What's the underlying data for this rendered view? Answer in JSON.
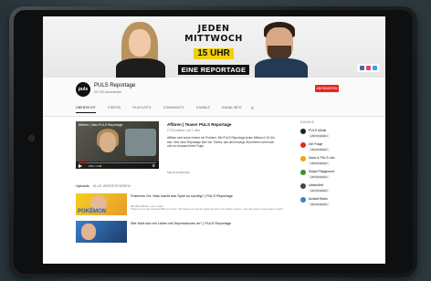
{
  "banner": {
    "line1": "JEDEN",
    "line2": "MITTWOCH",
    "line3": "15 UHR",
    "line4": "EINE REPORTAGE"
  },
  "channel": {
    "avatar_text": "puls",
    "name": "PULS Reportage",
    "subscribers": "60.726 Abonnenten",
    "subscribe_label": "ABONNIEREN"
  },
  "tabs": [
    {
      "label": "ÜBERSICHT",
      "active": true
    },
    {
      "label": "VIDEOS",
      "active": false
    },
    {
      "label": "PLAYLISTS",
      "active": false
    },
    {
      "label": "COMMUNITY",
      "active": false
    },
    {
      "label": "KANÄLE",
      "active": false
    },
    {
      "label": "KANALINFO",
      "active": false
    }
  ],
  "featured": {
    "video_title": "Affären | Was PULS Reportage",
    "time": "0:01 / 1:23",
    "title": "Affären | Teaser PULS Reportage",
    "meta": "2.720 Aufrufe • vor 1 Jahr",
    "description": "Affären sind schon immer ein Problem. Bei PULS Reportage jeden Mittwoch 15 Uhr neu: eine neue Reportage über ein Thema, das dich bewegt. Abonnieren lohnt sich und du verpasst keine Folge.",
    "more": "MEHR ANZEIGEN"
  },
  "section": {
    "title": "Uploads",
    "play_all": "ALLE WIEDERGEBEN"
  },
  "videos": [
    {
      "thumb_text": "POKÉMON",
      "title": "Pokémon Go: Was macht das Spiel so süchtig? | PULS Reportage",
      "meta": "26.430 Aufrufe • vor 1 Jahr",
      "description": "Pokémon Go hat weltweit Millionen Fans. Wir haben uns auf die Jagd gemacht und wollten wissen, was das Spiel so besonders macht ..."
    },
    {
      "thumb_text": "",
      "title": "Wie fühlt sich ein Leben mit Depressionen an? | PULS Reportage",
      "meta": "",
      "description": ""
    }
  ],
  "sidebar": {
    "title": "KANÄLE",
    "channels": [
      {
        "name": "PULS Musik",
        "button": "ABONNIEREN",
        "color": "#222222"
      },
      {
        "name": "Die Frage",
        "button": "ABONNIEREN",
        "color": "#e52620"
      },
      {
        "name": "Dans & PULS Lab",
        "button": "ABONNIEREN",
        "color": "#f2a500"
      },
      {
        "name": "Swipe Playground",
        "button": "ABONNIEREN",
        "color": "#3a8f3a"
      },
      {
        "name": "ultraviolett",
        "button": "ABONNIEREN",
        "color": "#444444"
      },
      {
        "name": "Anstalt Radio",
        "button": "ABONNIEREN",
        "color": "#3b7fc9"
      }
    ]
  },
  "colors": {
    "accent": "#e52620",
    "banner_highlight": "#f2d100"
  }
}
